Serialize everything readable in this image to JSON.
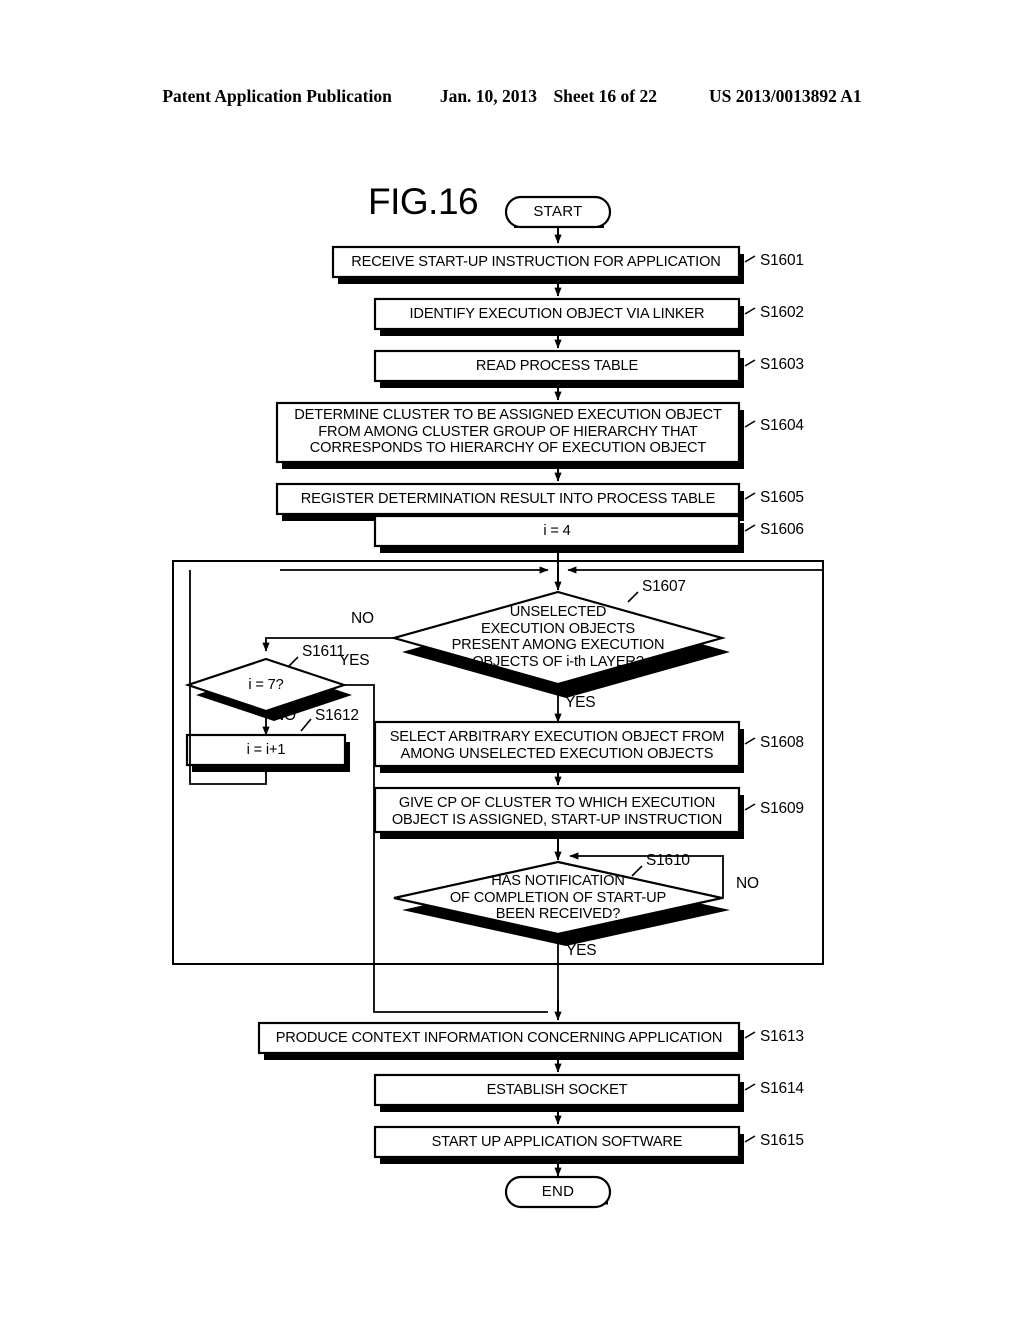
{
  "header": {
    "left": "Patent Application Publication",
    "date": "Jan. 10, 2013",
    "sheet": "Sheet 16 of 22",
    "doc_number": "US 2013/0013892 A1"
  },
  "figure": {
    "title": "FIG.16"
  },
  "terminals": {
    "start": "START",
    "end": "END"
  },
  "nodes": [
    {
      "id": "S1601",
      "label": "S1601",
      "text": "RECEIVE START-UP INSTRUCTION FOR APPLICATION",
      "shape": "process"
    },
    {
      "id": "S1602",
      "label": "S1602",
      "text": "IDENTIFY EXECUTION OBJECT VIA LINKER",
      "shape": "process"
    },
    {
      "id": "S1603",
      "label": "S1603",
      "text": "READ PROCESS TABLE",
      "shape": "process"
    },
    {
      "id": "S1604",
      "label": "S1604",
      "text": "DETERMINE CLUSTER TO BE ASSIGNED EXECUTION OBJECT\nFROM AMONG CLUSTER GROUP OF HIERARCHY THAT\nCORRESPONDS TO HIERARCHY OF EXECUTION OBJECT",
      "shape": "process"
    },
    {
      "id": "S1605",
      "label": "S1605",
      "text": "REGISTER DETERMINATION RESULT INTO PROCESS TABLE",
      "shape": "process"
    },
    {
      "id": "S1606",
      "label": "S1606",
      "text": "i = 4",
      "shape": "process"
    },
    {
      "id": "S1607",
      "label": "S1607",
      "text": "UNSELECTED\nEXECUTION OBJECTS\nPRESENT AMONG EXECUTION\nOBJECTS OF i-th LAYER?",
      "shape": "decision"
    },
    {
      "id": "S1608",
      "label": "S1608",
      "text": "SELECT ARBITRARY EXECUTION OBJECT FROM\nAMONG UNSELECTED EXECUTION OBJECTS",
      "shape": "process"
    },
    {
      "id": "S1609",
      "label": "S1609",
      "text": "GIVE CP OF CLUSTER TO WHICH EXECUTION\nOBJECT IS ASSIGNED, START-UP INSTRUCTION",
      "shape": "process"
    },
    {
      "id": "S1610",
      "label": "S1610",
      "text": "HAS NOTIFICATION\nOF COMPLETION OF START-UP\nBEEN RECEIVED?",
      "shape": "decision"
    },
    {
      "id": "S1611",
      "label": "S1611",
      "text": "i = 7?",
      "shape": "decision"
    },
    {
      "id": "S1612",
      "label": "S1612",
      "text": "i = i+1",
      "shape": "process"
    },
    {
      "id": "S1613",
      "label": "S1613",
      "text": "PRODUCE CONTEXT INFORMATION CONCERNING APPLICATION",
      "shape": "process"
    },
    {
      "id": "S1614",
      "label": "S1614",
      "text": "ESTABLISH SOCKET",
      "shape": "process"
    },
    {
      "id": "S1615",
      "label": "S1615",
      "text": "START UP APPLICATION SOFTWARE",
      "shape": "process"
    }
  ],
  "branch_labels": {
    "s1607_no": "NO",
    "s1607_yes_left": "YES",
    "s1607_yes_down": "YES",
    "s1611_yes": "YES",
    "s1611_no": "NO",
    "s1610_no": "NO",
    "s1610_yes": "YES"
  },
  "colors": {
    "ink": "#000000",
    "paper": "#ffffff"
  }
}
